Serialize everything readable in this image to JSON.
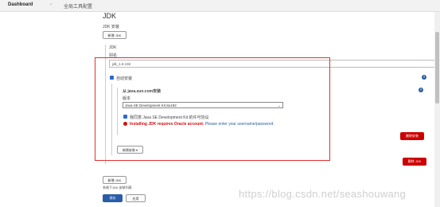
{
  "breadcrumb": {
    "dashboard": "Dashboard",
    "separator": "›",
    "page": "全局工具配置"
  },
  "jdk": {
    "heading": "JDK",
    "installations_label": "JDK 安装",
    "add_button": "新增 JDK",
    "section_title": "JDK",
    "name_label": "别名",
    "name_value": "jdk_1.8.192",
    "auto_install_label": "自动安装",
    "installer_title": "从 java.sun.com安装",
    "version_label": "版本",
    "version_value": "Java SE Development Kit 8u192",
    "license_label": "我同意 Java SE Development Kit 的许可协议",
    "error_bold": "Installing JDK requires Oracle account.",
    "error_link": "Please enter your username/password",
    "add_installer_button": "新增安装 ▾",
    "delete_installer_button": "删除安装",
    "delete_jdk_button": "删除 JDK",
    "add_jdk_bottom_button": "新增 JDK",
    "bottom_note": "系统下JDK 安装列表",
    "save_button": "保存",
    "apply_button": "应用"
  },
  "watermark": "https://blog.csdn.net/seashouwang",
  "colors": {
    "accent": "#2a5da8",
    "danger": "#cc0000",
    "highlight": "#e03030"
  }
}
